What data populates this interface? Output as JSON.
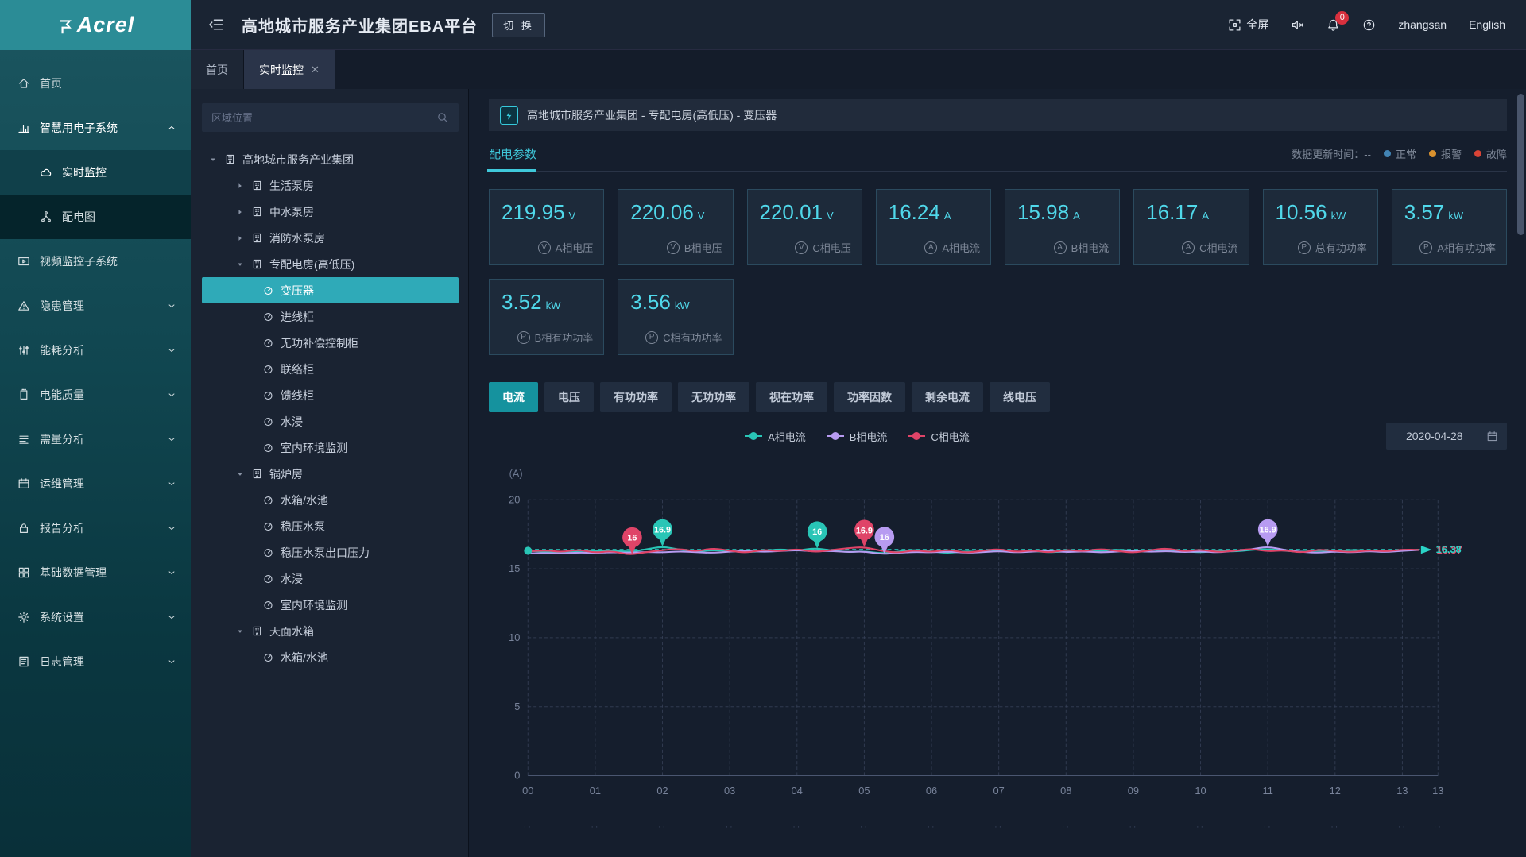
{
  "brand": {
    "logo_text": "Acrel"
  },
  "header": {
    "title": "高地城市服务产业集团EBA平台",
    "switch_label": "切 换",
    "fullscreen_label": "全屏",
    "notification_count": "0",
    "username": "zhangsan",
    "language": "English"
  },
  "tabs": [
    {
      "label": "首页",
      "active": false,
      "closable": false
    },
    {
      "label": "实时监控",
      "active": true,
      "closable": true
    }
  ],
  "sidebar": {
    "items": [
      {
        "label": "首页",
        "icon": "home-icon"
      },
      {
        "label": "智慧用电子系统",
        "icon": "bar-chart-icon",
        "caret": "up",
        "active": true,
        "children": [
          {
            "label": "实时监控",
            "icon": "cloud-icon",
            "active": true
          },
          {
            "label": "配电图",
            "icon": "diagram-icon"
          }
        ]
      },
      {
        "label": "视频监控子系统",
        "icon": "video-icon"
      },
      {
        "label": "隐患管理",
        "icon": "warning-icon",
        "caret": "down"
      },
      {
        "label": "能耗分析",
        "icon": "equalizer-icon",
        "caret": "down"
      },
      {
        "label": "电能质量",
        "icon": "battery-icon",
        "caret": "down"
      },
      {
        "label": "需量分析",
        "icon": "lines-icon",
        "caret": "down"
      },
      {
        "label": "运维管理",
        "icon": "calendar-icon",
        "caret": "down"
      },
      {
        "label": "报告分析",
        "icon": "lock-icon",
        "caret": "down"
      },
      {
        "label": "基础数据管理",
        "icon": "grid-icon",
        "caret": "down"
      },
      {
        "label": "系统设置",
        "icon": "gear-icon",
        "caret": "down"
      },
      {
        "label": "日志管理",
        "icon": "log-icon",
        "caret": "down"
      }
    ]
  },
  "tree": {
    "search_placeholder": "区域位置",
    "nodes": [
      {
        "label": "高地城市服务产业集团",
        "level": 0,
        "icon": "building",
        "caret": "expanded"
      },
      {
        "label": "生活泵房",
        "level": 1,
        "icon": "building",
        "caret": "collapsed"
      },
      {
        "label": "中水泵房",
        "level": 1,
        "icon": "building",
        "caret": "collapsed"
      },
      {
        "label": "消防水泵房",
        "level": 1,
        "icon": "building",
        "caret": "collapsed"
      },
      {
        "label": "专配电房(高低压)",
        "level": 1,
        "icon": "building",
        "caret": "expanded"
      },
      {
        "label": "变压器",
        "level": 2,
        "icon": "gauge",
        "selected": true
      },
      {
        "label": "进线柜",
        "level": 2,
        "icon": "gauge"
      },
      {
        "label": "无功补偿控制柜",
        "level": 2,
        "icon": "gauge"
      },
      {
        "label": "联络柜",
        "level": 2,
        "icon": "gauge"
      },
      {
        "label": "馈线柜",
        "level": 2,
        "icon": "gauge"
      },
      {
        "label": "水浸",
        "level": 2,
        "icon": "gauge"
      },
      {
        "label": "室内环境监测",
        "level": 2,
        "icon": "gauge"
      },
      {
        "label": "锅炉房",
        "level": 1,
        "icon": "building",
        "caret": "expanded"
      },
      {
        "label": "水箱/水池",
        "level": 2,
        "icon": "gauge"
      },
      {
        "label": "稳压水泵",
        "level": 2,
        "icon": "gauge"
      },
      {
        "label": "稳压水泵出口压力",
        "level": 2,
        "icon": "gauge"
      },
      {
        "label": "水浸",
        "level": 2,
        "icon": "gauge"
      },
      {
        "label": "室内环境监测",
        "level": 2,
        "icon": "gauge"
      },
      {
        "label": "天面水箱",
        "level": 1,
        "icon": "building",
        "caret": "expanded"
      },
      {
        "label": "水箱/水池",
        "level": 2,
        "icon": "gauge"
      }
    ]
  },
  "main": {
    "breadcrumb": "高地城市服务产业集团 - 专配电房(高低压) - 变压器",
    "section_tab": "配电参数",
    "status": {
      "update_label": "数据更新时间：--",
      "items": [
        {
          "label": "正常",
          "color": "#4284b4"
        },
        {
          "label": "报警",
          "color": "#d9912e"
        },
        {
          "label": "故障",
          "color": "#d94436"
        }
      ]
    },
    "cards": [
      {
        "value": "219.95",
        "unit": "V",
        "icon_letter": "V",
        "label": "A相电压"
      },
      {
        "value": "220.06",
        "unit": "V",
        "icon_letter": "V",
        "label": "B相电压"
      },
      {
        "value": "220.01",
        "unit": "V",
        "icon_letter": "V",
        "label": "C相电压"
      },
      {
        "value": "16.24",
        "unit": "A",
        "icon_letter": "A",
        "label": "A相电流"
      },
      {
        "value": "15.98",
        "unit": "A",
        "icon_letter": "A",
        "label": "B相电流"
      },
      {
        "value": "16.17",
        "unit": "A",
        "icon_letter": "A",
        "label": "C相电流"
      },
      {
        "value": "10.56",
        "unit": "kW",
        "icon_letter": "P",
        "label": "总有功功率"
      },
      {
        "value": "3.57",
        "unit": "kW",
        "icon_letter": "P",
        "label": "A相有功功率"
      },
      {
        "value": "3.52",
        "unit": "kW",
        "icon_letter": "P",
        "label": "B相有功功率"
      },
      {
        "value": "3.56",
        "unit": "kW",
        "icon_letter": "P",
        "label": "C相有功功率"
      }
    ],
    "chart_tabs": [
      {
        "label": "电流",
        "active": true
      },
      {
        "label": "电压"
      },
      {
        "label": "有功功率"
      },
      {
        "label": "无功功率"
      },
      {
        "label": "视在功率"
      },
      {
        "label": "功率因数"
      },
      {
        "label": "剩余电流"
      },
      {
        "label": "线电压"
      }
    ],
    "date": "2020-04-28"
  },
  "chart_data": {
    "type": "line",
    "unit": "(A)",
    "ylim": [
      0,
      20
    ],
    "yticks": [
      0,
      5,
      10,
      15,
      20
    ],
    "xticks": [
      "00",
      "01",
      "02",
      "03",
      "04",
      "05",
      "06",
      "07",
      "08",
      "09",
      "10",
      "11",
      "12",
      "13",
      "13"
    ],
    "x_start": 0,
    "x_step": 0.25,
    "grid": "dashed",
    "legend_position": "top-center",
    "series": [
      {
        "name": "A相电流",
        "color": "#29c5b6",
        "values": [
          16.3,
          16.22,
          16.18,
          16.3,
          16.26,
          16.34,
          16.22,
          16.4,
          16.62,
          16.38,
          16.26,
          16.35,
          16.28,
          16.18,
          16.3,
          16.42,
          16.3,
          16.5,
          16.34,
          16.2,
          16.28,
          16.1,
          16.24,
          16.38,
          16.26,
          16.12,
          16.28,
          16.2,
          16.32,
          16.22,
          16.3,
          16.18,
          16.26,
          16.36,
          16.28,
          16.4,
          16.3,
          16.22,
          16.34,
          16.26,
          16.18,
          16.3,
          16.24,
          16.36,
          16.44,
          16.3,
          16.22,
          16.32,
          16.26,
          16.38,
          16.3,
          16.24,
          16.34,
          16.38
        ]
      },
      {
        "name": "B相电流",
        "color": "#b79bf1",
        "values": [
          16.12,
          16.15,
          16.1,
          16.18,
          16.14,
          16.2,
          16.16,
          16.22,
          16.18,
          16.26,
          16.2,
          16.15,
          16.24,
          16.3,
          16.22,
          16.28,
          16.35,
          16.25,
          16.3,
          16.2,
          16.26,
          16.05,
          16.15,
          16.22,
          16.18,
          16.25,
          16.15,
          16.2,
          16.28,
          16.18,
          16.24,
          16.3,
          16.2,
          16.26,
          16.18,
          16.24,
          16.3,
          16.22,
          16.28,
          16.2,
          16.26,
          16.18,
          16.3,
          16.4,
          16.62,
          16.35,
          16.22,
          16.15,
          16.25,
          16.18,
          16.28,
          16.2,
          16.3,
          16.36
        ]
      },
      {
        "name": "C相电流",
        "color": "#df4468",
        "values": [
          16.25,
          16.35,
          16.2,
          16.4,
          16.15,
          16.3,
          16.0,
          16.2,
          16.35,
          16.45,
          16.25,
          16.5,
          16.3,
          16.15,
          16.4,
          16.25,
          16.45,
          16.2,
          16.35,
          16.5,
          16.58,
          16.3,
          16.15,
          16.35,
          16.2,
          16.4,
          16.15,
          16.3,
          16.45,
          16.2,
          16.35,
          16.15,
          16.4,
          16.25,
          16.45,
          16.3,
          16.15,
          16.35,
          16.5,
          16.25,
          16.4,
          16.2,
          16.3,
          16.45,
          16.25,
          16.35,
          16.15,
          16.4,
          16.3,
          16.2,
          16.35,
          16.25,
          16.4,
          16.37
        ]
      }
    ],
    "markers": [
      {
        "series": 2,
        "x": 1.55,
        "label": "16"
      },
      {
        "series": 0,
        "x": 2.0,
        "label": "16.9"
      },
      {
        "series": 0,
        "x": 4.3,
        "label": "16"
      },
      {
        "series": 2,
        "x": 5.0,
        "label": "16.9"
      },
      {
        "series": 1,
        "x": 5.3,
        "label": "16"
      },
      {
        "series": 1,
        "x": 11.0,
        "label": "16.9"
      }
    ],
    "reference": {
      "value": 16.38,
      "label": "16.38",
      "color": "#2ad3c6",
      "shadow_label": "16.37",
      "shadow_color": "#e0516f"
    }
  }
}
